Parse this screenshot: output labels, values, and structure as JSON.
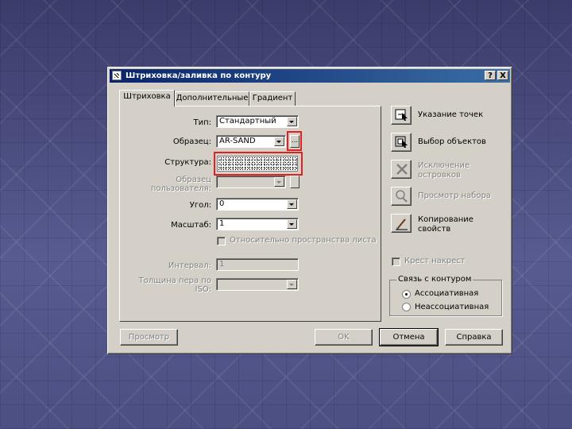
{
  "window": {
    "title": "Штриховка/заливка по контуру",
    "help_btn": "?",
    "close_btn": "X"
  },
  "tabs": [
    {
      "label": "Штриховка",
      "active": true
    },
    {
      "label": "Дополнительные",
      "active": false
    },
    {
      "label": "Градиент",
      "active": false
    }
  ],
  "hatch": {
    "type": {
      "label": "Тип:",
      "value": "Стандартный"
    },
    "pattern": {
      "label": "Образец:",
      "value": "AR-SAND",
      "browse": "..."
    },
    "swatch": {
      "label": "Структура:"
    },
    "custom": {
      "label_line1": "Образец",
      "label_line2": "пользователя:",
      "value": ""
    },
    "angle": {
      "label": "Угол:",
      "value": "0"
    },
    "scale": {
      "label": "Масштаб:",
      "value": "1"
    },
    "relative": {
      "label": "Относительно пространства листа",
      "checked": false
    },
    "spacing": {
      "label": "Интервал:",
      "value": "1"
    },
    "iso": {
      "label_line1": "Толщина пера по",
      "label_line2": "ISO:",
      "value": ""
    }
  },
  "actions": {
    "pick_points": "Указание точек",
    "select_objects": "Выбор объектов",
    "remove_islands_1": "Исключение",
    "remove_islands_2": "островков",
    "view_selections": "Просмотр набора",
    "inherit_1": "Копирование",
    "inherit_2": "свойств"
  },
  "double": {
    "label": "Крест накрест",
    "checked": false
  },
  "composition": {
    "title": "Связь с контуром",
    "associative": "Ассоциативная",
    "nonassociative": "Неассоциативная",
    "selected": "associative"
  },
  "buttons": {
    "preview": "Просмотр",
    "ok": "OK",
    "cancel": "Отмена",
    "help": "Справка"
  },
  "colors": {
    "highlight": "#dd2222",
    "titlebar": "#0a246a",
    "dialog_face": "#d4d0c8"
  }
}
